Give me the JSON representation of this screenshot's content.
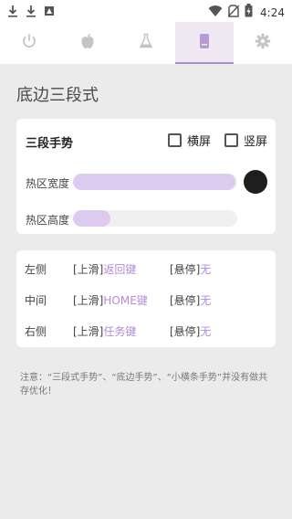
{
  "status_bar": {
    "time": "4:24",
    "icons": [
      "download-icon",
      "download-icon",
      "image-icon",
      "wifi-icon",
      "no-sim-icon",
      "battery-charging-icon"
    ]
  },
  "tabs": [
    {
      "icon": "power-icon",
      "active": false
    },
    {
      "icon": "apple-icon",
      "active": false
    },
    {
      "icon": "flask-icon",
      "active": false
    },
    {
      "icon": "phone-icon",
      "active": true
    },
    {
      "icon": "gear-icon",
      "active": false
    }
  ],
  "page_title": "底边三段式",
  "settings_card": {
    "title": "三段手势",
    "landscape_label": "横屏",
    "landscape_checked": false,
    "portrait_label": "竖屏",
    "portrait_checked": false,
    "width_label": "热区宽度",
    "width_value_fraction": 0.99,
    "height_label": "热区高度",
    "height_value_fraction": 0.23
  },
  "gestures": [
    {
      "name": "左侧",
      "swipe_prefix": "[上滑]",
      "swipe_value": "返回键",
      "hover_prefix": "[悬停]",
      "hover_value": "无"
    },
    {
      "name": "中间",
      "swipe_prefix": "[上滑]",
      "swipe_value": "HOME键",
      "hover_prefix": "[悬停]",
      "hover_value": "无"
    },
    {
      "name": "右侧",
      "swipe_prefix": "[上滑]",
      "swipe_value": "任务键",
      "hover_prefix": "[悬停]",
      "hover_value": "无"
    }
  ],
  "note": "注意：“三段式手势”、“底边手势”、“小横条手势”并没有做共存优化！",
  "colors": {
    "accent": "#a890c8",
    "fill": "#dccbee",
    "value_text": "#b38bd6"
  }
}
